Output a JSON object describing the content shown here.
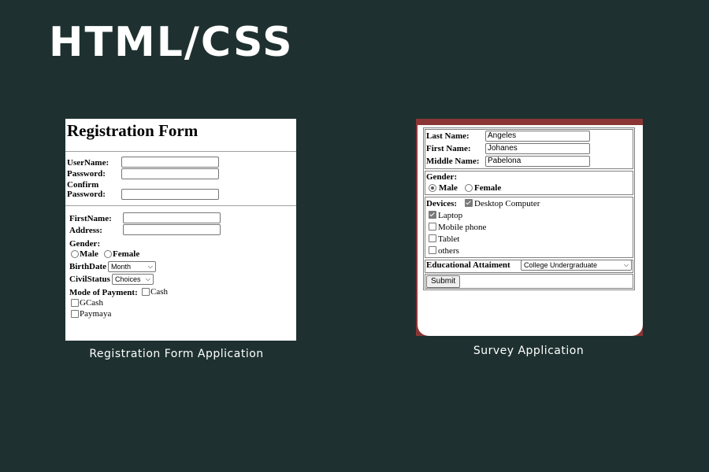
{
  "slide": {
    "title": "HTML/CSS",
    "captions": {
      "registration": "Registration Form Application",
      "survey": "Survey Application"
    }
  },
  "registration_form": {
    "title": "Registration Form",
    "labels": {
      "username": "UserName:",
      "password": "Password:",
      "confirm": "Confirm",
      "confirm_password": "Password:",
      "firstname": "FirstName:",
      "address": "Address:",
      "gender": "Gender:",
      "male": "Male",
      "female": "Female",
      "birthdate": "BirthDate",
      "civilstatus": "CivilStatus",
      "mode_of_payment": "Mode of Payment:",
      "cash": "Cash",
      "gcash": "GCash",
      "paymaya": "Paymaya"
    },
    "values": {
      "username": "",
      "password": "",
      "confirm_password": "",
      "firstname": "",
      "address": ""
    },
    "birthdate_select": "Month",
    "civilstatus_select": "Choices"
  },
  "survey_form": {
    "labels": {
      "last_name": "Last Name:",
      "first_name": "First Name:",
      "middle_name": "Middle Name:",
      "gender": "Gender:",
      "male": "Male",
      "female": "Female",
      "devices": "Devices:",
      "desktop": "Desktop Computer",
      "laptop": "Laptop",
      "mobile": "Mobile phone",
      "tablet": "Tablet",
      "others": "others",
      "education": "Educational Attaiment"
    },
    "values": {
      "last_name": "Angeles",
      "first_name": "Johanes",
      "middle_name": "Pabelona"
    },
    "gender_selected": "Male",
    "devices_checked": [
      "Desktop Computer",
      "Laptop"
    ],
    "education_select": "College Undergraduate",
    "submit_label": "Submit"
  },
  "colors": {
    "background": "#1e3130",
    "survey_border": "#8b3535"
  },
  "icons": {
    "select_caret": "chevron-down-icon"
  }
}
